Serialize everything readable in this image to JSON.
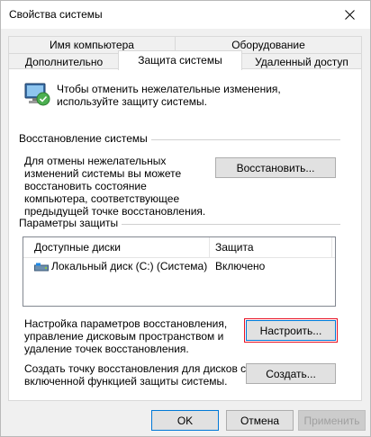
{
  "window": {
    "title": "Свойства системы"
  },
  "tabs": {
    "row1": [
      "Имя компьютера",
      "Оборудование"
    ],
    "row2": [
      "Дополнительно",
      "Защита системы",
      "Удаленный доступ"
    ]
  },
  "intro": {
    "text": "Чтобы отменить нежелательные изменения, используйте защиту системы."
  },
  "restore": {
    "group_title": "Восстановление системы",
    "description": "Для отмены нежелательных изменений системы вы можете восстановить состояние компьютера, соответствующее предыдущей точке восстановления.",
    "button": "Восстановить..."
  },
  "protection": {
    "group_title": "Параметры защиты",
    "columns": [
      "Доступные диски",
      "Защита"
    ],
    "rows": [
      {
        "drive": "Локальный диск (C:) (Система)",
        "status": "Включено"
      }
    ],
    "configure_text": "Настройка параметров восстановления, управление дисковым пространством и удаление точек восстановления.",
    "configure_button": "Настроить...",
    "create_text": "Создать точку восстановления для дисков с включенной функцией защиты системы.",
    "create_button": "Создать..."
  },
  "footer": {
    "ok": "OK",
    "cancel": "Отмена",
    "apply": "Применить"
  },
  "colors": {
    "accent": "#0078d7",
    "highlight_border": "#e81123"
  },
  "icons": {
    "close": "close-icon",
    "system_protection": "system-protection-icon",
    "drive": "drive-icon"
  }
}
